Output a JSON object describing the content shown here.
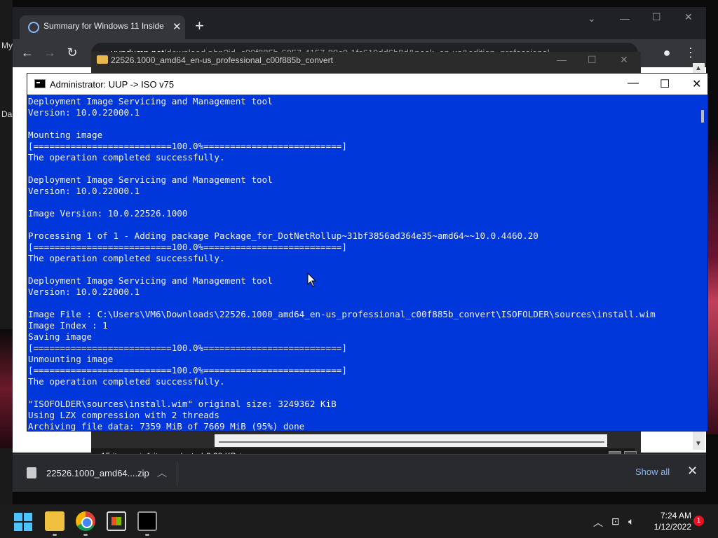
{
  "desktop": {
    "left_text_1": "My",
    "left_text_2": "Da"
  },
  "chrome": {
    "tab_title": "Summary for Windows 11 Insider",
    "url_prefix": "uupdump.net",
    "url_rest": "/download.php?id=c00f885b-6057-4157-89c0-1fc619dd6b8d&pack=en-us&edition=professional"
  },
  "explorer": {
    "title": "22526.1000_amd64_en-us_professional_c00f885b_convert",
    "item_count": "15 items",
    "selection": "1 item selected",
    "size": "3.38 KB"
  },
  "cmd": {
    "title": "Administrator:  UUP -> ISO v75",
    "lines": [
      "Deployment Image Servicing and Management tool",
      "Version: 10.0.22000.1",
      "",
      "Mounting image",
      "[==========================100.0%==========================]",
      "The operation completed successfully.",
      "",
      "Deployment Image Servicing and Management tool",
      "Version: 10.0.22000.1",
      "",
      "Image Version: 10.0.22526.1000",
      "",
      "Processing 1 of 1 - Adding package Package_for_DotNetRollup~31bf3856ad364e35~amd64~~10.0.4460.20",
      "[==========================100.0%==========================]",
      "The operation completed successfully.",
      "",
      "Deployment Image Servicing and Management tool",
      "Version: 10.0.22000.1",
      "",
      "Image File : C:\\Users\\VM6\\Downloads\\22526.1000_amd64_en-us_professional_c00f885b_convert\\ISOFOLDER\\sources\\install.wim",
      "Image Index : 1",
      "Saving image",
      "[==========================100.0%==========================]",
      "Unmounting image",
      "[==========================100.0%==========================]",
      "The operation completed successfully.",
      "",
      "\"ISOFOLDER\\sources\\install.wim\" original size: 3249362 KiB",
      "Using LZX compression with 2 threads",
      "Archiving file data: 7359 MiB of 7669 MiB (95%) done"
    ]
  },
  "download_shelf": {
    "file_name": "22526.1000_amd64....zip",
    "show_all": "Show all"
  },
  "taskbar": {
    "time": "7:24 AM",
    "date": "1/12/2022",
    "notification_count": "1"
  }
}
